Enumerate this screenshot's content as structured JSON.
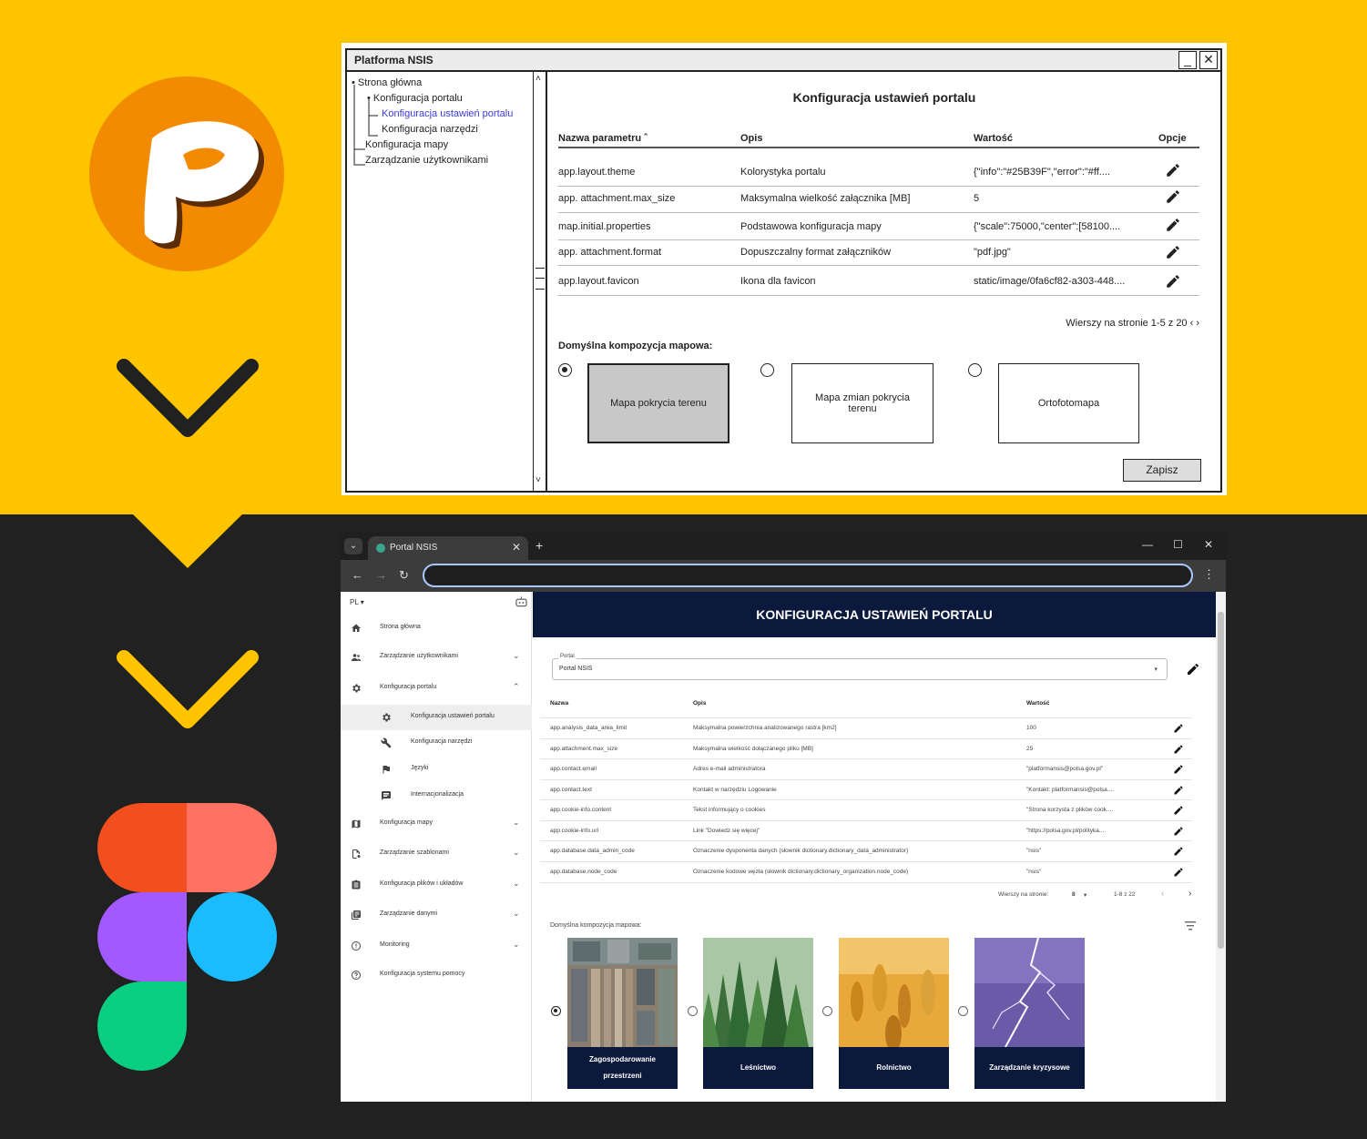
{
  "wireframe": {
    "window_title": "Platforma NSIS",
    "minimize_icon": "minimize-icon",
    "close_icon": "close-icon",
    "tree": [
      {
        "label": "Strona główna",
        "level": 0,
        "bullet": "•"
      },
      {
        "label": "Konfiguracja portalu",
        "level": 1,
        "bullet": "•"
      },
      {
        "label": "Konfiguracja ustawień portalu",
        "level": 2,
        "active": true
      },
      {
        "label": "Konfiguracja narzędzi",
        "level": 2
      },
      {
        "label": "Konfiguracja mapy",
        "level": 1
      },
      {
        "label": "Zarządzanie użytkownikami",
        "level": 1
      }
    ],
    "heading": "Konfiguracja ustawień portalu",
    "columns": {
      "name": "Nazwa parametru ˆ",
      "desc": "Opis",
      "value": "Wartość",
      "options": "Opcje"
    },
    "rows": [
      {
        "name": "app.layout.theme",
        "desc": "Kolorystyka portalu",
        "value": "{\"info\":\"#25B39F\",\"error\":\"#ff...."
      },
      {
        "name": "app. attachment.max_size",
        "desc": "Maksymalna wielkość załącznika [MB]",
        "value": "5"
      },
      {
        "name": "map.initial.properties",
        "desc": "Podstawowa konfiguracja mapy",
        "value": "{\"scale\":75000,\"center\":[58100...."
      },
      {
        "name": "app. attachment.format",
        "desc": "Dopuszczalny format załączników",
        "value": "\"pdf.jpg\""
      },
      {
        "name": "app.layout.favicon",
        "desc": "Ikona dla favicon",
        "value": "static/image/0fa6cf82-a303-448...."
      }
    ],
    "pager": "Wierszy na stronie 1-5 z 20 ‹ ›",
    "composition_label": "Domyślna kompozycja mapowa:",
    "cards": [
      {
        "label": "Mapa pokrycia terenu",
        "selected": true
      },
      {
        "label": "Mapa zmian pokrycia terenu",
        "selected": false
      },
      {
        "label": "Ortofotomapa",
        "selected": false
      }
    ],
    "save_label": "Zapisz"
  },
  "browser": {
    "tab_title": "Portal NSIS",
    "tab_close": "✕",
    "new_tab": "+",
    "tab_menu": "⌄",
    "nav_back": "←",
    "nav_forward": "→",
    "nav_reload": "↻",
    "menu_dots": "⋮",
    "win_min": "—",
    "win_max": "☐",
    "win_close": "✕"
  },
  "sidebar": {
    "lang": "PL ▾",
    "items": [
      {
        "label": "Strona główna",
        "icon": "home-icon",
        "chevron": ""
      },
      {
        "label": "Zarządzanie użytkownikami",
        "icon": "users-icon",
        "chevron": "⌄"
      },
      {
        "label": "Konfiguracja portalu",
        "icon": "gear-icon",
        "chevron": "⌃"
      },
      {
        "label": "Konfiguracja ustawień portalu",
        "icon": "gear-icon",
        "chevron": "",
        "active": true
      },
      {
        "label": "Konfiguracja narzędzi",
        "icon": "wrench-icon",
        "chevron": ""
      },
      {
        "label": "Języki",
        "icon": "flag-icon",
        "chevron": ""
      },
      {
        "label": "Internacjonalizacja",
        "icon": "message-icon",
        "chevron": ""
      },
      {
        "label": "Konfiguracja mapy",
        "icon": "map-icon",
        "chevron": "⌄"
      },
      {
        "label": "Zarządzanie szablonami",
        "icon": "template-icon",
        "chevron": "⌄"
      },
      {
        "label": "Konfiguracja plików i układów",
        "icon": "document-icon",
        "chevron": "⌄"
      },
      {
        "label": "Zarządzanie danymi",
        "icon": "data-icon",
        "chevron": "⌄"
      },
      {
        "label": "Monitoring",
        "icon": "alert-icon",
        "chevron": "⌄"
      },
      {
        "label": "Konfiguracja systemu pomocy",
        "icon": "help-icon",
        "chevron": ""
      }
    ]
  },
  "main": {
    "header": "KONFIGURACJA USTAWIEŃ PORTALU",
    "select_legend": "Portal",
    "select_value": "Portal NSIS",
    "select_caret": "▾",
    "columns": {
      "name": "Nazwa",
      "desc": "Opis",
      "value": "Wartość"
    },
    "rows": [
      {
        "name": "app.analysis_data_area_limit",
        "desc": "Maksymalna powierzchnia analizowanego rastra [km2]",
        "value": "100"
      },
      {
        "name": "app.attachment.max_size",
        "desc": "Maksymalna wielkość dołączanego pliku [MB]",
        "value": "25"
      },
      {
        "name": "app.contact.email",
        "desc": "Adres e-mail administratora",
        "value": "\"platformansis@polsa.gov.pl\""
      },
      {
        "name": "app.contact.text",
        "desc": "Kontakt w narzędziu Logowanie",
        "value": "\"Kontakt: platformansis@polsa...."
      },
      {
        "name": "app.cookie-info.content",
        "desc": "Tekst informujący o cookies",
        "value": "\"Strona korzysta z plików cook...."
      },
      {
        "name": "app.cookie-info.url",
        "desc": "Link \"Dowiedz się więcej\"",
        "value": "\"https://polsa.gov.pl/polityka...."
      },
      {
        "name": "app.database.data_admin_code",
        "desc": "Oznaczenie dysponenta danych (słownik dictionary.dictionary_data_administrator)",
        "value": "\"nsis\""
      },
      {
        "name": "app.database.node_code",
        "desc": "Oznaczenie kodowe węzła (słownik dictionary.dictionary_organization.node_code)",
        "value": "\"nsis\""
      }
    ],
    "pager": {
      "rows_label": "Wierszy na stronie:",
      "rows_value": "8",
      "caret": "▾",
      "range": "1-8 z 22",
      "prev": "‹",
      "next": "›"
    },
    "composition_label": "Domyślna kompozycja mapowa:",
    "cards": [
      {
        "label": "Zagospodarowanie przestrzeni",
        "selected": true,
        "image": "aerial-city-image"
      },
      {
        "label": "Leśnictwo",
        "selected": false,
        "image": "forest-image"
      },
      {
        "label": "Rolnictwo",
        "selected": false,
        "image": "wheat-image"
      },
      {
        "label": "Zarządzanie kryzysowe",
        "selected": false,
        "image": "lightning-image"
      }
    ]
  },
  "colors": {
    "background_top": "#ffc400",
    "background_bottom": "#212121",
    "app_header": "#0b1a3c",
    "logo_orange": "#f38b00"
  }
}
